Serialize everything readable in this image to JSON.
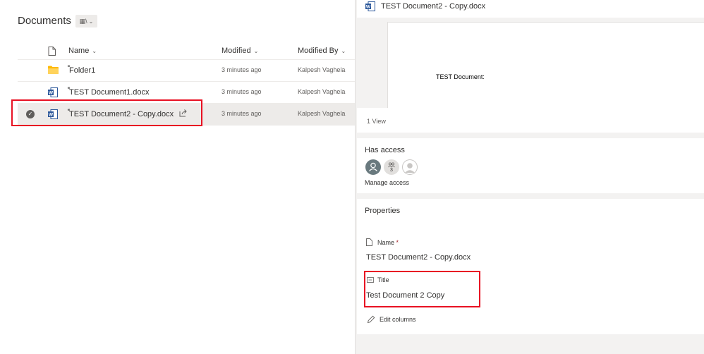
{
  "library": {
    "title": "Documents",
    "view_icon": "library-view-icon"
  },
  "columns": {
    "name": "Name",
    "modified": "Modified",
    "modified_by": "Modified By"
  },
  "rows": [
    {
      "name": "Folder1",
      "type": "folder-icon",
      "modified": "3 minutes ago",
      "modified_by": "Kalpesh Vaghela"
    },
    {
      "name": "TEST Document1.docx",
      "type": "word-doc-icon",
      "modified": "3 minutes ago",
      "modified_by": "Kalpesh Vaghela"
    },
    {
      "name": "TEST Document2 - Copy.docx",
      "type": "word-doc-icon",
      "modified": "3 minutes ago",
      "modified_by": "Kalpesh Vaghela",
      "selected": true
    }
  ],
  "details": {
    "file_name": "TEST Document2 - Copy.docx",
    "preview_text": "TEST Document:",
    "views": "1 View",
    "has_access_label": "Has access",
    "group_count": "3",
    "manage_access": "Manage access",
    "properties_label": "Properties",
    "name_label": "Name",
    "name_required": "*",
    "name_value": "TEST Document2 - Copy.docx",
    "title_label": "Title",
    "title_value": "Test Document 2 Copy",
    "edit_columns": "Edit columns"
  },
  "colors": {
    "highlight": "#e81123",
    "folder": "#ffb900",
    "word": "#2b579a"
  }
}
